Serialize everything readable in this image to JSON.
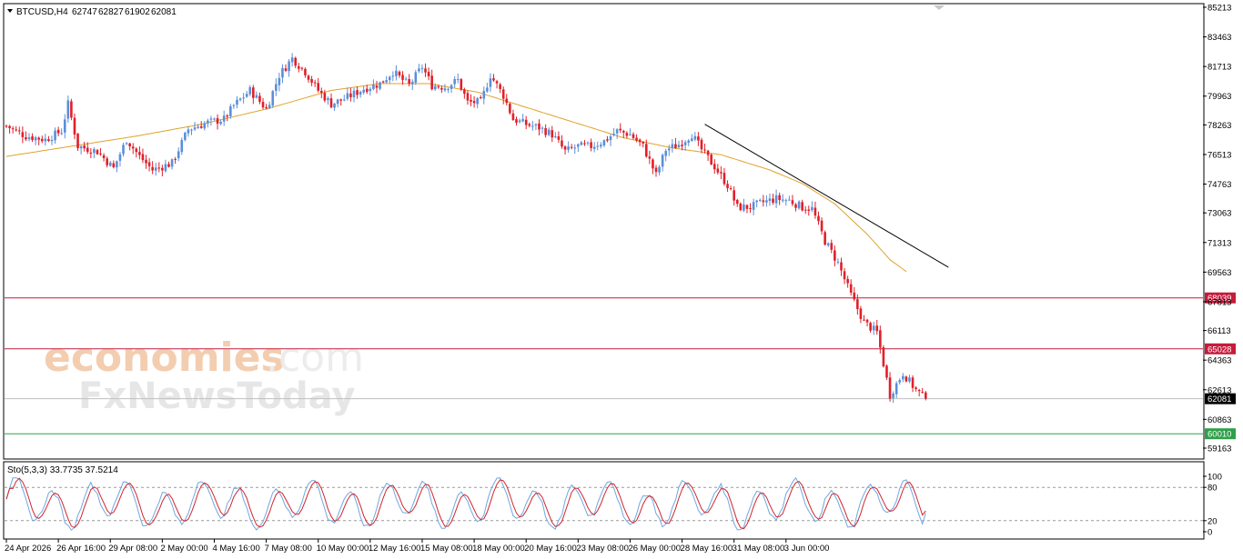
{
  "header": {
    "symbol": "BTCUSD,H4",
    "open": "62747",
    "high": "62827",
    "low": "61902",
    "close": "62081"
  },
  "watermark": {
    "brand1": "economies",
    "brand1_suffix": ".com",
    "brand2": "FxNewsToday"
  },
  "indicator": {
    "label": "Sto(5,3,3) 33.7735 37.5214"
  },
  "colors": {
    "bull": "#5b8fd9",
    "bear": "#e0202a",
    "ma": "#e0a22a",
    "level": "#c41c3c",
    "support": "#2fa04a",
    "current": "#c0c0c0"
  },
  "chart_data": [
    {
      "type": "candlestick",
      "symbol": "BTCUSD",
      "timeframe": "H4",
      "ylim": [
        59163,
        85213
      ],
      "y_ticks": [
        85213,
        83463,
        81713,
        79963,
        78263,
        76513,
        74763,
        73063,
        71313,
        69563,
        67813,
        66113,
        64363,
        62613,
        60863,
        59163
      ],
      "x_tick_labels": [
        "24 Apr 2026",
        "26 Apr 16:00",
        "29 Apr 08:00",
        "2 May 00:00",
        "4 May 16:00",
        "7 May 08:00",
        "10 May 00:00",
        "12 May 16:00",
        "15 May 08:00",
        "18 May 00:00",
        "20 May 16:00",
        "23 May 08:00",
        "26 May 00:00",
        "28 May 16:00",
        "31 May 08:00",
        "3 Jun 00:00"
      ],
      "candle_count": 244,
      "price_path": [
        [
          0,
          78200
        ],
        [
          6,
          77600
        ],
        [
          12,
          77400
        ],
        [
          17,
          77900
        ],
        [
          19,
          79500
        ],
        [
          22,
          77000
        ],
        [
          28,
          76700
        ],
        [
          33,
          75700
        ],
        [
          37,
          77400
        ],
        [
          41,
          76400
        ],
        [
          45,
          75600
        ],
        [
          51,
          76000
        ],
        [
          56,
          78000
        ],
        [
          62,
          78400
        ],
        [
          67,
          78600
        ],
        [
          70,
          79400
        ],
        [
          75,
          80300
        ],
        [
          80,
          79200
        ],
        [
          84,
          81200
        ],
        [
          88,
          82200
        ],
        [
          92,
          81400
        ],
        [
          96,
          80300
        ],
        [
          100,
          79500
        ],
        [
          104,
          79800
        ],
        [
          110,
          80400
        ],
        [
          115,
          80700
        ],
        [
          119,
          81400
        ],
        [
          124,
          80600
        ],
        [
          128,
          81700
        ],
        [
          131,
          80600
        ],
        [
          135,
          80500
        ],
        [
          139,
          80900
        ],
        [
          142,
          79600
        ],
        [
          146,
          79600
        ],
        [
          149,
          81200
        ],
        [
          153,
          80000
        ],
        [
          156,
          78600
        ],
        [
          160,
          78300
        ],
        [
          164,
          78100
        ],
        [
          168,
          77700
        ],
        [
          172,
          76700
        ],
        [
          176,
          77000
        ],
        [
          180,
          77000
        ],
        [
          184,
          77300
        ],
        [
          188,
          77900
        ],
        [
          192,
          77700
        ],
        [
          196,
          77000
        ],
        [
          200,
          75300
        ],
        [
          203,
          76800
        ],
        [
          207,
          77100
        ],
        [
          211,
          77700
        ],
        [
          214,
          76800
        ],
        [
          218,
          75800
        ],
        [
          222,
          74700
        ],
        [
          225,
          73400
        ],
        [
          229,
          73400
        ],
        [
          233,
          73700
        ],
        [
          237,
          73900
        ],
        [
          241,
          73800
        ],
        [
          245,
          73400
        ],
        [
          248,
          73300
        ],
        [
          252,
          71400
        ],
        [
          256,
          70100
        ],
        [
          260,
          68200
        ],
        [
          264,
          66600
        ],
        [
          268,
          66000
        ],
        [
          272,
          62300
        ],
        [
          276,
          63600
        ],
        [
          280,
          62600
        ],
        [
          283,
          62081
        ]
      ],
      "moving_average_path": [
        [
          0,
          76400
        ],
        [
          20,
          77000
        ],
        [
          40,
          77600
        ],
        [
          60,
          78300
        ],
        [
          80,
          79200
        ],
        [
          100,
          80300
        ],
        [
          115,
          80700
        ],
        [
          130,
          80700
        ],
        [
          145,
          80200
        ],
        [
          160,
          79300
        ],
        [
          175,
          78400
        ],
        [
          190,
          77500
        ],
        [
          205,
          76900
        ],
        [
          220,
          76500
        ],
        [
          235,
          75600
        ],
        [
          245,
          74800
        ],
        [
          255,
          73600
        ],
        [
          265,
          71800
        ],
        [
          272,
          70300
        ],
        [
          277,
          69600
        ]
      ],
      "horizontal_levels": [
        {
          "price": 68039,
          "label": "68039"
        },
        {
          "price": 65028,
          "label": "65028"
        },
        {
          "price": 60010,
          "label": "60010"
        }
      ],
      "current_price": {
        "price": 62081,
        "label": "62081"
      },
      "trendline": {
        "start": [
          215,
          78300
        ],
        "end": [
          290,
          69850
        ]
      }
    },
    {
      "type": "line",
      "name": "Sto(5,3,3)",
      "ylim": [
        0,
        100
      ],
      "y_ticks": [
        100,
        80,
        20,
        0
      ],
      "levels": [
        80,
        20
      ],
      "main_last": 33.7735,
      "signal_last": 37.5214
    }
  ]
}
